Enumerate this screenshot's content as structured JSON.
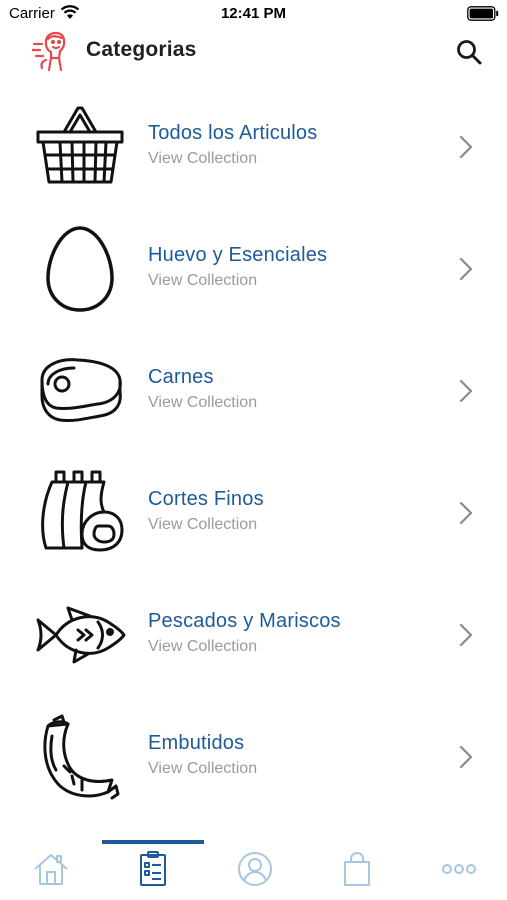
{
  "status_bar": {
    "carrier": "Carrier",
    "time": "12:41 PM"
  },
  "header": {
    "title": "Categorias",
    "logo_icon": "delivery-mascot-icon",
    "search_icon": "search-icon"
  },
  "categories": [
    {
      "title": "Todos los Articulos",
      "subtitle": "View Collection",
      "icon": "basket-icon"
    },
    {
      "title": "Huevo y Esenciales",
      "subtitle": "View Collection",
      "icon": "egg-icon"
    },
    {
      "title": "Carnes",
      "subtitle": "View Collection",
      "icon": "steak-icon"
    },
    {
      "title": "Cortes Finos",
      "subtitle": "View Collection",
      "icon": "rack-ribs-icon"
    },
    {
      "title": "Pescados y Mariscos",
      "subtitle": "View Collection",
      "icon": "fish-icon"
    },
    {
      "title": "Embutidos",
      "subtitle": "View Collection",
      "icon": "sausage-icon"
    }
  ],
  "tab_bar": {
    "active_tab": "list",
    "tabs": [
      "home-icon",
      "list-icon",
      "profile-icon",
      "bag-icon",
      "more-icon"
    ]
  },
  "colors": {
    "accent": "#1e5a99",
    "subtitle": "#9b9b9b",
    "tab_inactive": "#a9c6e0",
    "logo": "#e8494c"
  }
}
